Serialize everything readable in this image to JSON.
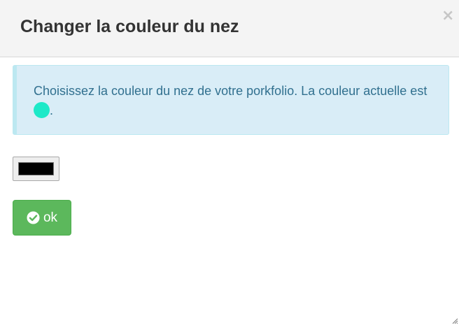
{
  "dialog": {
    "title": "Changer la couleur du nez",
    "close_label": "×"
  },
  "alert": {
    "text_before": "Choisissez la couleur du nez de votre porkfolio. La couleur actuelle est ",
    "text_after": ".",
    "current_color": "#1de9c8"
  },
  "color_input": {
    "value": "#000000"
  },
  "ok_button": {
    "label": "ok",
    "icon": "check-circle-icon"
  },
  "colors": {
    "header_bg": "#f4f4f4",
    "alert_bg": "#d9edf7",
    "alert_text": "#31708f",
    "success": "#5cb85c"
  }
}
